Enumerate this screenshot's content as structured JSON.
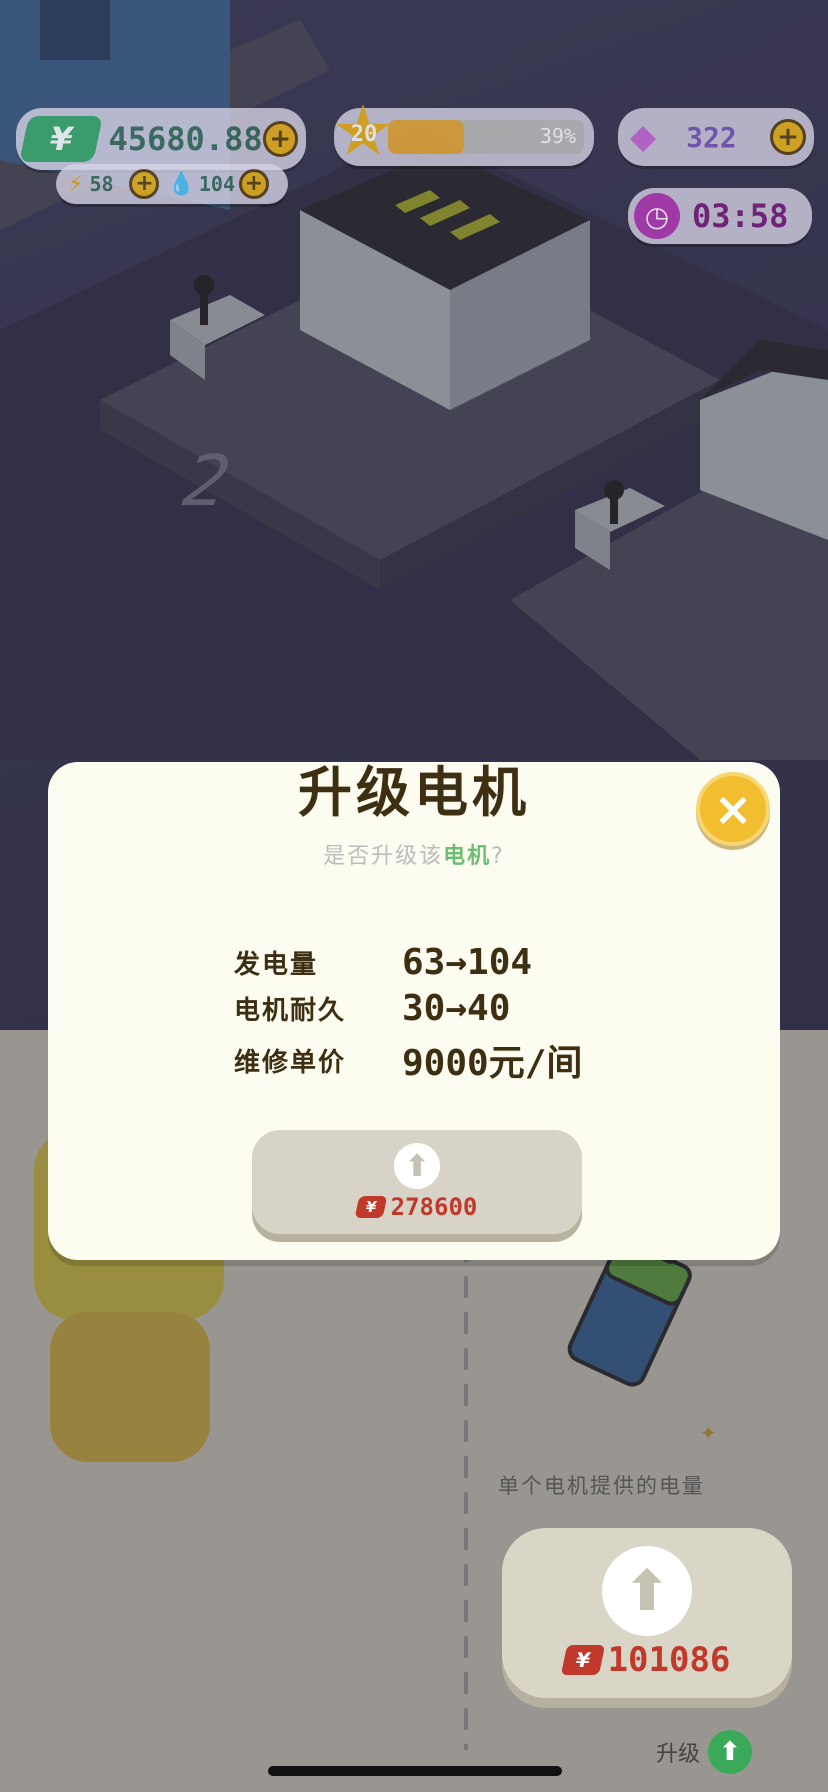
{
  "hud": {
    "money": "45680.88",
    "energy": "58",
    "water": "104",
    "level": "20",
    "level_progress_text": "39%",
    "level_progress": 0.39,
    "gems": "322",
    "timer": "03:58",
    "money_icon": "¥"
  },
  "modal": {
    "title": "升级电机",
    "subtitle_prefix": "是否升级该",
    "subtitle_highlight": "电机",
    "subtitle_suffix": "?",
    "close_icon": "×",
    "stats": [
      {
        "label": "发电量",
        "value": "63→104"
      },
      {
        "label": "电机耐久",
        "value": "30→40"
      },
      {
        "label": "维修单价",
        "value": "9000元/间"
      }
    ],
    "upgrade_price": "278600",
    "currency_badge": "¥"
  },
  "bottom": {
    "battery_label": "单个电机提供的电量",
    "big_upgrade_price": "101086",
    "upgrade_label": "升级",
    "currency_badge": "¥"
  },
  "colors": {
    "accent_gold": "#e8b21c",
    "hud_text": "#3b6e5c",
    "price_red": "#c0392b",
    "highlight_green": "#6cbf72"
  }
}
